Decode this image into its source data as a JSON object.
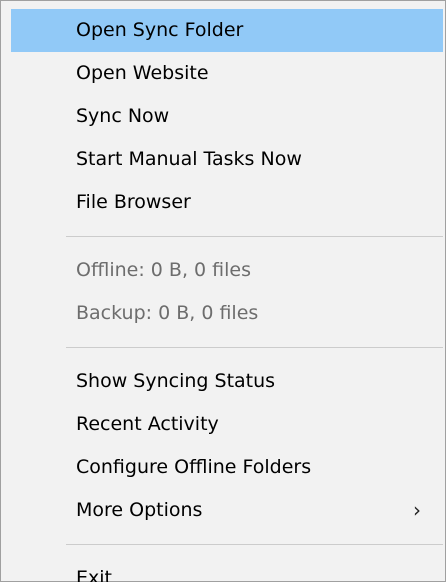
{
  "menu": {
    "open_sync_folder": "Open Sync Folder",
    "open_website": "Open Website",
    "sync_now": "Sync Now",
    "start_manual_tasks_now": "Start Manual Tasks Now",
    "file_browser": "File Browser",
    "offline_status": "Offline: 0 B, 0 files",
    "backup_status": "Backup: 0 B, 0 files",
    "show_syncing_status": "Show Syncing Status",
    "recent_activity": "Recent Activity",
    "configure_offline_folders": "Configure Offline Folders",
    "more_options": "More Options",
    "more_options_arrow": "›",
    "exit": "Exit"
  },
  "colors": {
    "menu_background": "#f2f2f2",
    "highlight": "#91c9f7",
    "disabled_text": "#6d6d6d",
    "separator": "#cccccc"
  },
  "icons": {
    "submenu_arrow": "chevron-right-icon"
  }
}
